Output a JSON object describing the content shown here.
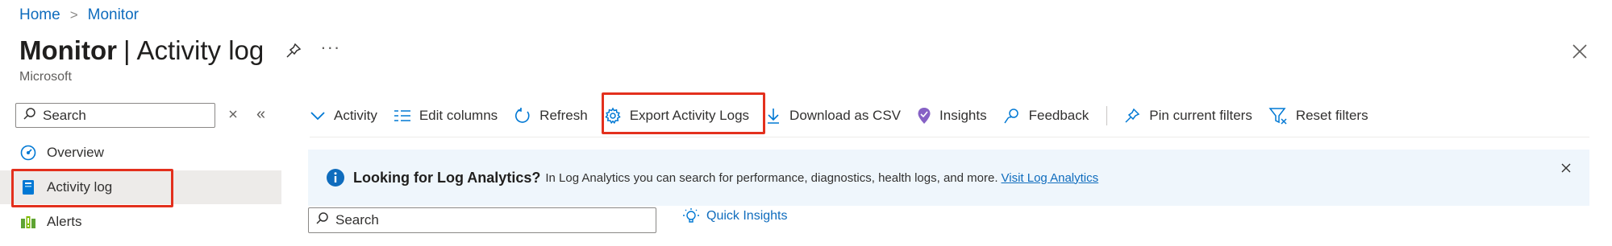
{
  "breadcrumb": {
    "home": "Home",
    "separator": ">",
    "current": "Monitor"
  },
  "header": {
    "title_bold": "Monitor",
    "title_separator": "|",
    "title_rest": "Activity log",
    "subtitle": "Microsoft",
    "more_label": "···",
    "pin_icon": "pin-icon",
    "close_icon": "close-icon"
  },
  "nav": {
    "search_placeholder": "Search",
    "collapse_label": "«",
    "items": [
      {
        "label": "Overview",
        "icon": "overview-icon",
        "selected": false
      },
      {
        "label": "Activity log",
        "icon": "activity-log-icon",
        "selected": true
      },
      {
        "label": "Alerts",
        "icon": "alerts-icon",
        "selected": false
      }
    ]
  },
  "toolbar": {
    "activity": "Activity",
    "edit_columns": "Edit columns",
    "refresh": "Refresh",
    "export_activity_logs": "Export Activity Logs",
    "download_csv": "Download as CSV",
    "insights": "Insights",
    "feedback": "Feedback",
    "pin_filters": "Pin current filters",
    "reset_filters": "Reset filters"
  },
  "banner": {
    "title": "Looking for Log Analytics?",
    "text": "In Log Analytics you can search for performance, diagnostics, health logs, and more.",
    "link": "Visit Log Analytics"
  },
  "main": {
    "search_placeholder": "Search",
    "quick_insights": "Quick Insights"
  },
  "colors": {
    "accent": "#0f6cbd",
    "highlight": "#e3301d",
    "banner_bg": "#eff6fc",
    "selected_bg": "#edebe9"
  }
}
